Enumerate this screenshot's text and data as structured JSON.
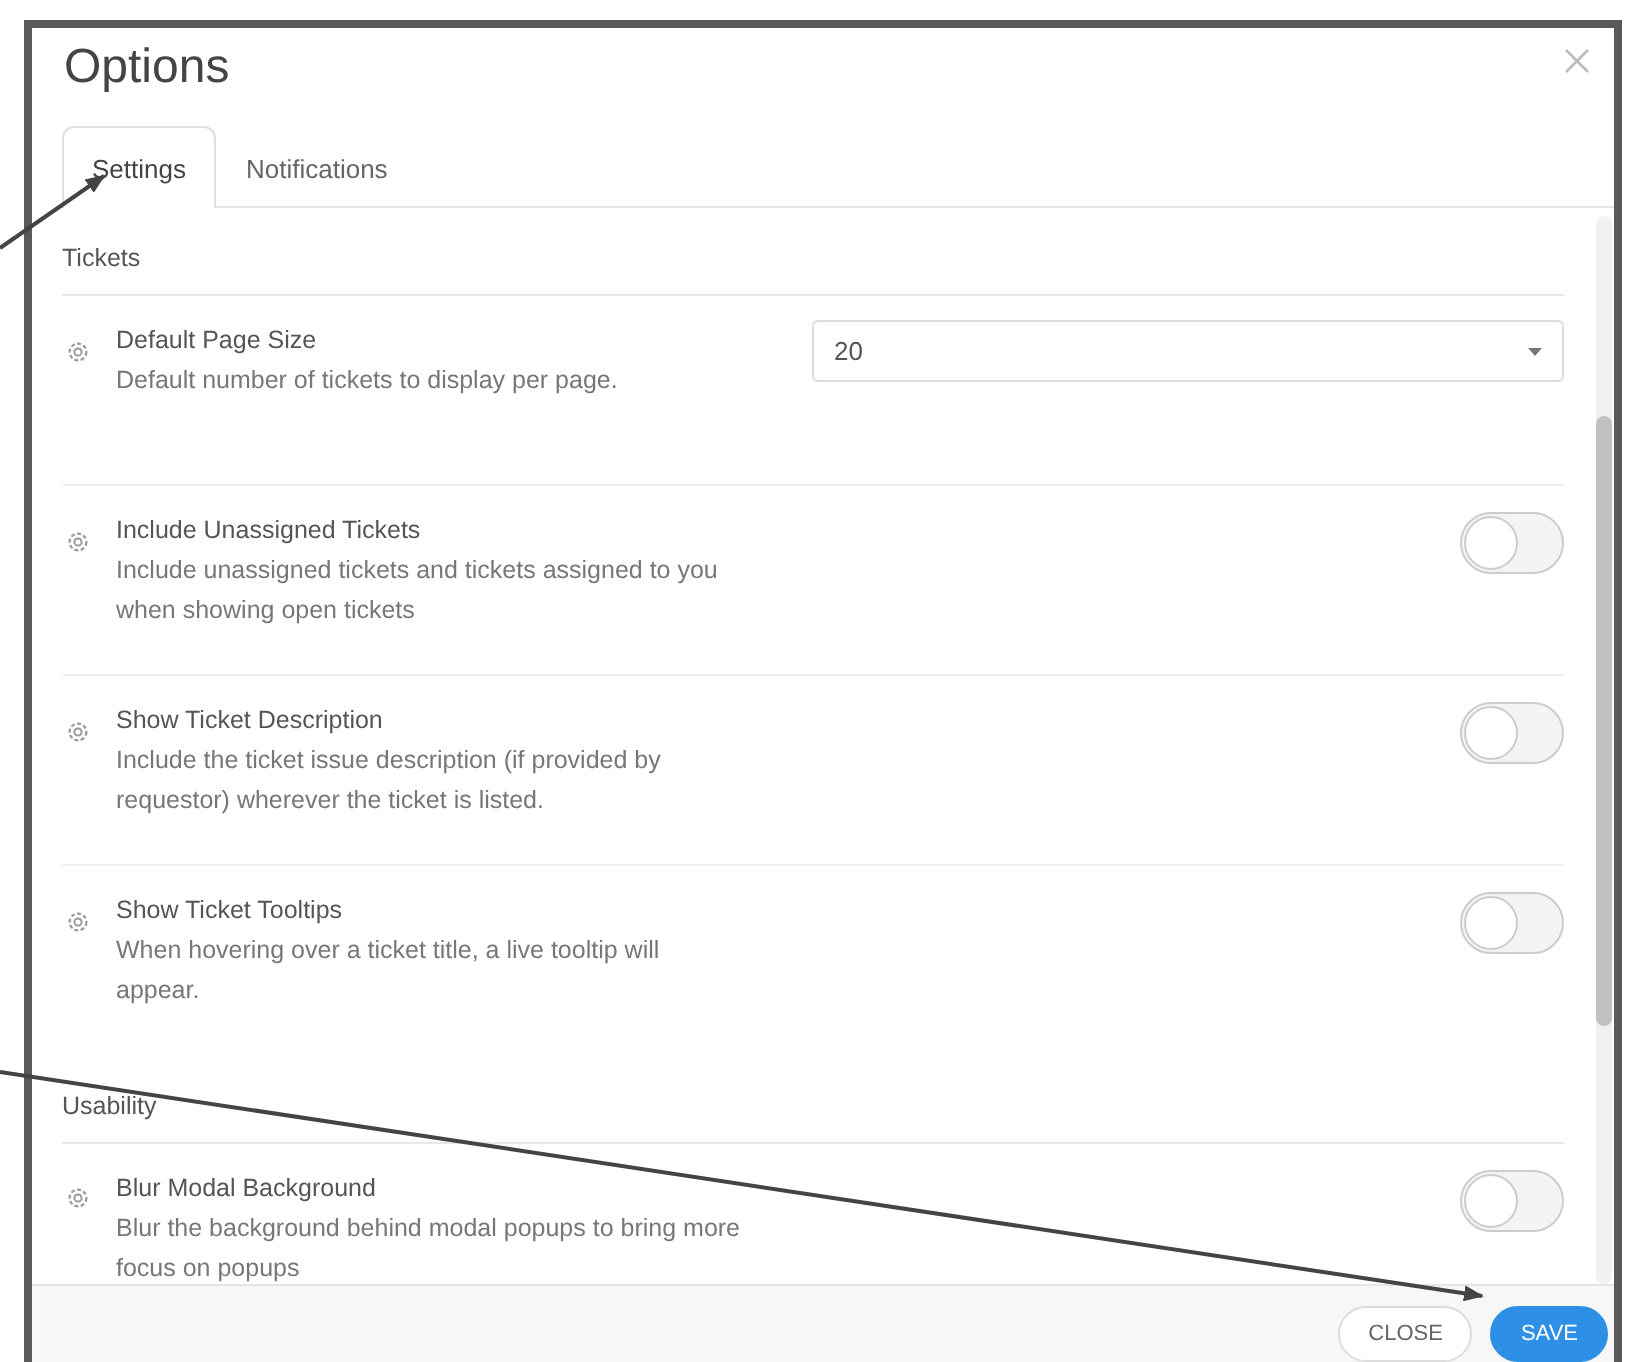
{
  "window": {
    "title": "Options"
  },
  "tabs": [
    {
      "label": "Settings",
      "selected": true
    },
    {
      "label": "Notifications",
      "selected": false
    }
  ],
  "sections": [
    {
      "title": "Tickets",
      "settings": [
        {
          "kind": "select",
          "title": "Default Page Size",
          "description": "Default number of tickets to display per page.",
          "value": "20"
        },
        {
          "kind": "toggle",
          "title": "Include Unassigned Tickets",
          "description": "Include unassigned tickets and tickets assigned to you when showing open tickets",
          "on": false
        },
        {
          "kind": "toggle",
          "title": "Show Ticket Description",
          "description": "Include the ticket issue description (if provided by requestor) wherever the ticket is listed.",
          "on": false
        },
        {
          "kind": "toggle",
          "title": "Show Ticket Tooltips",
          "description": "When hovering over a ticket title, a live tooltip will appear.",
          "on": false
        }
      ]
    },
    {
      "title": "Usability",
      "settings": [
        {
          "kind": "toggle",
          "title": "Blur Modal Background",
          "description": "Blur the background behind modal popups to bring more focus on popups",
          "on": false
        }
      ]
    }
  ],
  "footer": {
    "buttons": [
      {
        "label": "CLOSE",
        "kind": "secondary"
      },
      {
        "label": "SAVE",
        "kind": "primary"
      }
    ]
  }
}
